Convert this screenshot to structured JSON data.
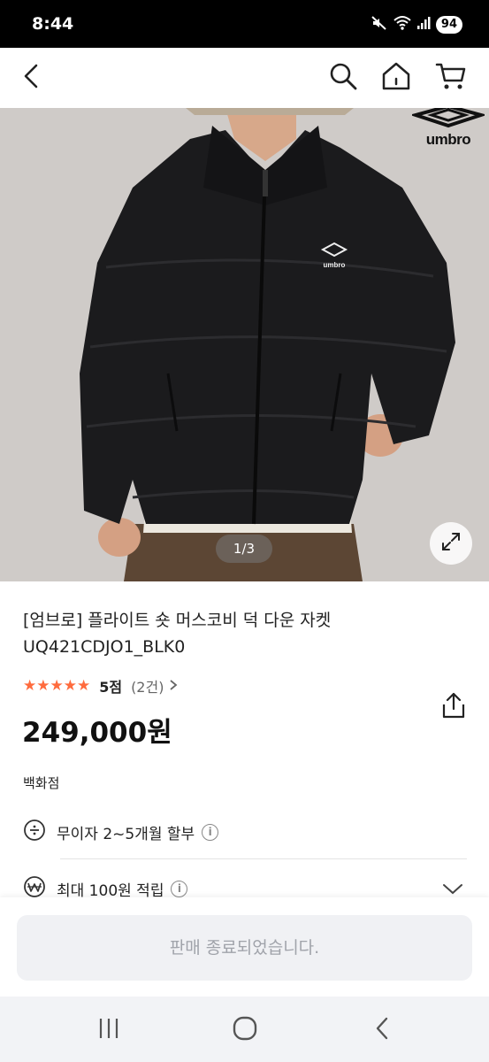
{
  "status_bar": {
    "time": "8:44",
    "battery": "94",
    "icons": [
      "mute-icon",
      "wifi-icon",
      "signal-icon"
    ]
  },
  "header": {
    "icons": [
      "back-icon",
      "search-icon",
      "home-icon",
      "cart-icon"
    ]
  },
  "gallery": {
    "brand_logo": "umbro",
    "chest_logo": "umbro",
    "counter": "1/3",
    "current_index": 1,
    "total": 3,
    "expand_icon": "expand-icon"
  },
  "product": {
    "title": "[엄브로] 플라이트 숏 머스코비 덕 다운 자켓 UQ421CDJO1_BLK0",
    "stars": "★★★★★",
    "rating_value": 5,
    "rating_label": "5점",
    "review_count_label": "(2건)",
    "price": "249,000원",
    "share_icon": "share-icon"
  },
  "seller": {
    "channel": "백화점"
  },
  "benefits": [
    {
      "icon": "installment-icon",
      "text": "무이자 2~5개월 할부"
    },
    {
      "icon": "point-icon",
      "text": "최대 100원 적립"
    }
  ],
  "bottom": {
    "button_label": "판매 종료되었습니다."
  },
  "colors": {
    "accent_star": "#ff6b3d",
    "disabled_button_bg": "#f0f1f4",
    "disabled_button_text": "#a0a3aa"
  },
  "nav": {
    "icons": [
      "recent-apps-icon",
      "home-circle-icon",
      "back-nav-icon"
    ]
  }
}
